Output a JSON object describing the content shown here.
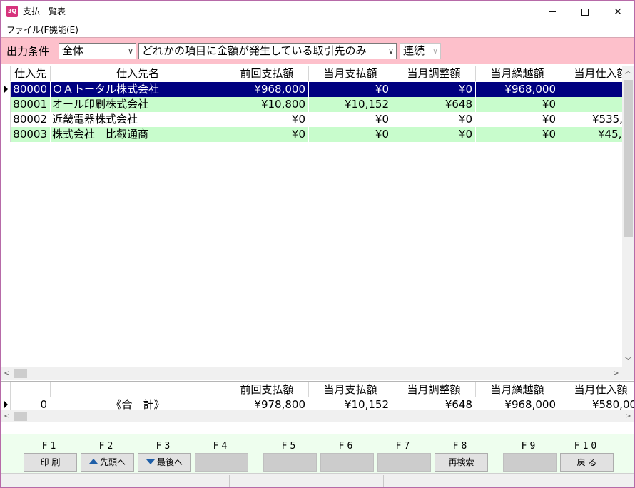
{
  "window": {
    "app_icon_text": "3Q",
    "title": "支払一覧表"
  },
  "menu": {
    "file": "ファイル(F)",
    "function": "機能(E)"
  },
  "filter": {
    "label": "出力条件",
    "scope_value": "全体",
    "condition_value": "どれかの項目に金額が発生している取引先のみ",
    "mode_value": "連続"
  },
  "grid": {
    "columns": [
      "仕入先",
      "仕入先名",
      "前回支払額",
      "当月支払額",
      "当月調整額",
      "当月繰越額",
      "当月仕入額"
    ],
    "rows": [
      {
        "code": "80000",
        "name": "ＯＡトータル株式会社",
        "prev_paid": "¥968,000",
        "month_paid": "¥0",
        "adjust": "¥0",
        "carry": "¥968,000",
        "purchase": ""
      },
      {
        "code": "80001",
        "name": "オール印刷株式会社",
        "prev_paid": "¥10,800",
        "month_paid": "¥10,152",
        "adjust": "¥648",
        "carry": "¥0",
        "purchase": ""
      },
      {
        "code": "80002",
        "name": "近畿電器株式会社",
        "prev_paid": "¥0",
        "month_paid": "¥0",
        "adjust": "¥0",
        "carry": "¥0",
        "purchase": "¥535,"
      },
      {
        "code": "80003",
        "name": "株式会社　比叡通商",
        "prev_paid": "¥0",
        "month_paid": "¥0",
        "adjust": "¥0",
        "carry": "¥0",
        "purchase": "¥45,"
      }
    ]
  },
  "totals": {
    "columns": [
      "前回支払額",
      "当月支払額",
      "当月調整額",
      "当月繰越額",
      "当月仕入額"
    ],
    "count": "0",
    "label": "《合　計》",
    "prev_paid": "¥978,800",
    "month_paid": "¥10,152",
    "adjust": "¥648",
    "carry": "¥968,000",
    "purchase": "¥580,00"
  },
  "fkeys": [
    {
      "key": "F1",
      "label": "印 刷"
    },
    {
      "key": "F2",
      "label": "先頭へ"
    },
    {
      "key": "F3",
      "label": "最後へ"
    },
    {
      "key": "F4",
      "label": ""
    },
    {
      "key": "F5",
      "label": ""
    },
    {
      "key": "F6",
      "label": ""
    },
    {
      "key": "F7",
      "label": ""
    },
    {
      "key": "F8",
      "label": "再検索"
    },
    {
      "key": "F9",
      "label": ""
    },
    {
      "key": "F10",
      "label": "戻 る"
    }
  ],
  "colors": {
    "filter_bg": "#fdc0cb",
    "row_green": "#c8fccc",
    "row_selected": "#000080",
    "fkey_panel": "#eefeee"
  }
}
